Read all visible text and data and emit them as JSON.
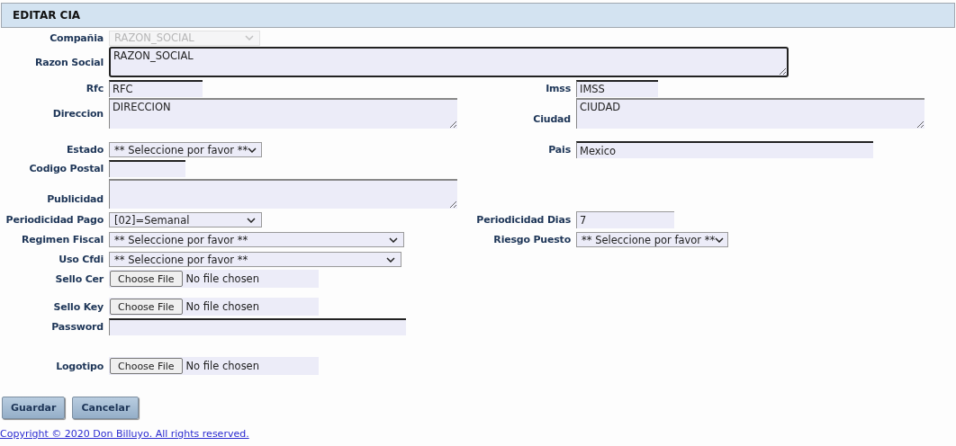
{
  "header": {
    "title": "EDITAR CIA"
  },
  "rows": [
    {
      "left": {
        "label": "Compañia",
        "kind": "select",
        "value": "RAZON_SOCIAL",
        "disabled": true,
        "focused": false
      }
    },
    {
      "left": {
        "label": "Razon Social",
        "kind": "textarea",
        "value": "RAZON_SOCIAL",
        "disabled": false,
        "focused": true
      }
    },
    {
      "left": {
        "label": "Rfc",
        "kind": "text",
        "value": "RFC",
        "disabled": false,
        "focused": false
      },
      "right": {
        "label": "Imss",
        "kind": "text",
        "value": "IMSS",
        "disabled": false,
        "focused": false
      }
    },
    {
      "left": {
        "label": "Direccion",
        "kind": "textarea",
        "value": "DIRECCION",
        "disabled": false,
        "focused": false
      },
      "right": {
        "label": "Ciudad",
        "kind": "textarea",
        "value": "CIUDAD",
        "disabled": false,
        "focused": false
      }
    },
    {
      "left": {
        "label": "Estado",
        "kind": "select",
        "value": "** Seleccione por favor **",
        "disabled": false,
        "focused": false
      },
      "right": {
        "label": "Pais",
        "kind": "text",
        "value": "Mexico",
        "disabled": false,
        "focused": false
      }
    },
    {
      "left": {
        "label": "Codigo Postal",
        "kind": "text",
        "disabled": false,
        "focused": false
      }
    },
    {
      "left": {
        "label": "Publicidad",
        "kind": "textarea",
        "disabled": false,
        "focused": false
      }
    },
    {
      "left": {
        "label": "Periodicidad Pago",
        "kind": "select",
        "value": "[02]=Semanal",
        "disabled": false,
        "focused": false
      },
      "right": {
        "label": "Periodicidad Dias",
        "kind": "number",
        "value": "7",
        "disabled": false,
        "focused": false
      }
    },
    {
      "left": {
        "label": "Regimen Fiscal",
        "kind": "select",
        "value": "** Seleccione por favor **",
        "disabled": false,
        "focused": false
      },
      "right": {
        "label": "Riesgo Puesto",
        "kind": "select",
        "value": "** Seleccione por favor **",
        "disabled": false,
        "focused": false
      }
    },
    {
      "left": {
        "label": "Uso Cfdi",
        "kind": "select",
        "value": "** Seleccione por favor **",
        "disabled": false,
        "focused": false
      }
    },
    {
      "left": {
        "label": "Sello Cer",
        "kind": "file",
        "button": "Choose File",
        "status": "No file chosen",
        "disabled": false,
        "focused": false
      }
    },
    {
      "left": {
        "label": "Sello Key",
        "kind": "file",
        "button": "Choose File",
        "status": "No file chosen",
        "disabled": false,
        "focused": false
      }
    },
    {
      "left": {
        "label": "Password",
        "kind": "text",
        "disabled": false,
        "focused": false
      }
    },
    {
      "left": {
        "label": "Logotipo",
        "kind": "file",
        "button": "Choose File",
        "status": "No file chosen",
        "disabled": false,
        "focused": false
      }
    }
  ],
  "buttons": [
    "Guardar",
    "Cancelar"
  ],
  "footer": {
    "copyright": "Copyright © 2020 Don Billuyo. All rights reserved."
  }
}
